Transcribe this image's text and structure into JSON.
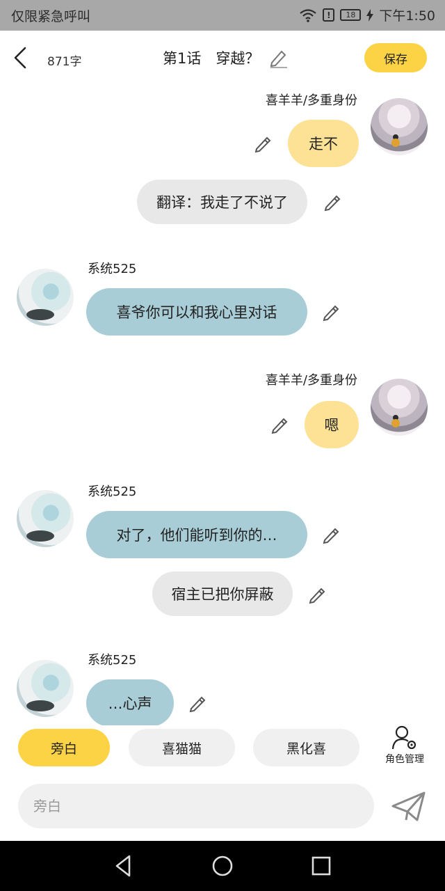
{
  "status": {
    "carrier": "仅限紧急呼叫",
    "battery": "18",
    "time": "下午1:50"
  },
  "header": {
    "word_count": "871字",
    "title": "第1话　穿越？",
    "save_label": "保存"
  },
  "messages": [
    {
      "sender": "喜羊羊/多重身份",
      "text": "走不",
      "side": "right",
      "style": "yellow",
      "avatar": "host"
    },
    {
      "text": "翻译：我走了不说了",
      "style": "gray"
    },
    {
      "sender": "系统525",
      "text": "喜爷你可以和我心里对话",
      "side": "left",
      "style": "blue",
      "avatar": "system"
    },
    {
      "sender": "喜羊羊/多重身份",
      "text": "嗯",
      "side": "right",
      "style": "yellow",
      "avatar": "host"
    },
    {
      "sender": "系统525",
      "text": "对了，他们能听到你的…",
      "side": "left",
      "style": "blue",
      "avatar": "system"
    },
    {
      "text": "宿主已把你屏蔽",
      "style": "gray"
    },
    {
      "sender": "系统525",
      "text": "…心声",
      "side": "left",
      "style": "blue",
      "avatar": "system"
    }
  ],
  "roles": {
    "chips": [
      "旁白",
      "喜猫猫",
      "黑化喜"
    ],
    "active": "旁白",
    "manage_label": "角色管理"
  },
  "input": {
    "placeholder": "旁白"
  },
  "colors": {
    "accent_yellow": "#fcd344",
    "bubble_yellow": "#fde295",
    "bubble_blue": "#a9cdd6",
    "bubble_gray": "#e8e8e8"
  },
  "icons": [
    "wifi-icon",
    "warning-icon",
    "battery-icon",
    "charging-icon",
    "back-arrow-icon",
    "pencil-icon",
    "edit-icon",
    "role-manage-icon",
    "send-icon",
    "nav-back-icon",
    "nav-home-icon",
    "nav-recents-icon"
  ]
}
